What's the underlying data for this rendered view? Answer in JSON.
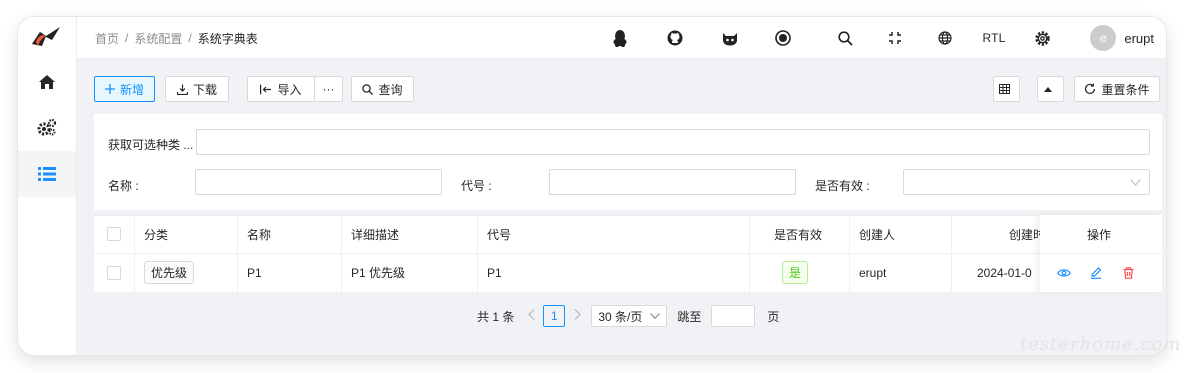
{
  "breadcrumb": {
    "home": "首页",
    "parent": "系统配置",
    "current": "系统字典表",
    "sep": "/"
  },
  "topbar": {
    "rtl_label": "RTL",
    "avatar_letter": "e",
    "username": "erupt"
  },
  "toolbar": {
    "add_label": "新增",
    "download_label": "下载",
    "import_label": "导入",
    "more_label": "···",
    "query_label": "查询",
    "reset_label": "重置条件"
  },
  "filter": {
    "category_label": "获取可选种类 ...",
    "name_label": "名称 :",
    "code_label": "代号 :",
    "valid_label": "是否有效 :",
    "category_value": "",
    "name_value": "",
    "code_value": "",
    "valid_value": ""
  },
  "table": {
    "headers": {
      "category": "分类",
      "name": "名称",
      "desc": "详细描述",
      "code": "代号",
      "valid": "是否有效",
      "creator": "创建人",
      "created": "创建时",
      "ops": "操作"
    },
    "rows": [
      {
        "category": "优先级",
        "name": "P1",
        "desc": "P1 优先级",
        "code": "P1",
        "valid": "是",
        "creator": "erupt",
        "created": "2024-01-0"
      }
    ]
  },
  "pagination": {
    "total_text": "共 1 条",
    "page": "1",
    "page_size": "30 条/页",
    "jump_label": "跳至",
    "page_unit": "页"
  },
  "watermark": "testerhome.com",
  "colors": {
    "primary": "#1890ff",
    "success": "#52c41a",
    "danger": "#ff4d4f",
    "nav_active": "#1890ff"
  }
}
